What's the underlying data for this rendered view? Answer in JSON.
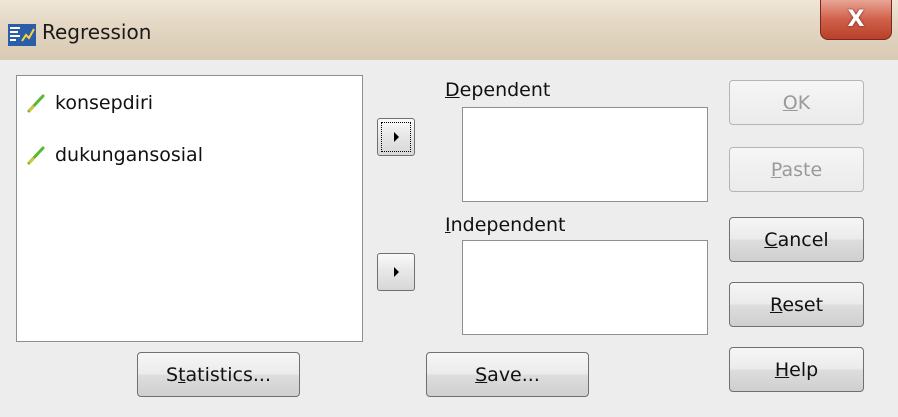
{
  "window": {
    "title": "Regression",
    "close_label": "X"
  },
  "variables": {
    "items": [
      {
        "label": "konsepdiri"
      },
      {
        "label": "dukungansosial"
      }
    ]
  },
  "dependent": {
    "label_mnemonic": "D",
    "label_rest": "ependent",
    "value": ""
  },
  "independent": {
    "label_mnemonic": "I",
    "label_rest": "ndependent",
    "value": ""
  },
  "buttons": {
    "ok": {
      "mnemonic": "O",
      "rest": "K",
      "enabled": false
    },
    "paste": {
      "mnemonic": "P",
      "rest": "aste",
      "enabled": false
    },
    "cancel": {
      "mnemonic": "C",
      "rest": "ancel",
      "enabled": true
    },
    "reset": {
      "mnemonic": "R",
      "rest": "eset",
      "enabled": true
    },
    "help": {
      "mnemonic": "H",
      "rest": "elp",
      "enabled": true
    },
    "statistics": {
      "before": "S",
      "mnemonic": "t",
      "rest": "atistics..."
    },
    "save": {
      "mnemonic": "S",
      "rest": "ave..."
    }
  },
  "icons": {
    "app": "spss-dialog-icon",
    "variable": "scale-variable-ruler-icon",
    "arrow": "right-triangle-icon"
  },
  "colors": {
    "variable_icon": "#58b82e",
    "close_button": "#c8503a"
  }
}
